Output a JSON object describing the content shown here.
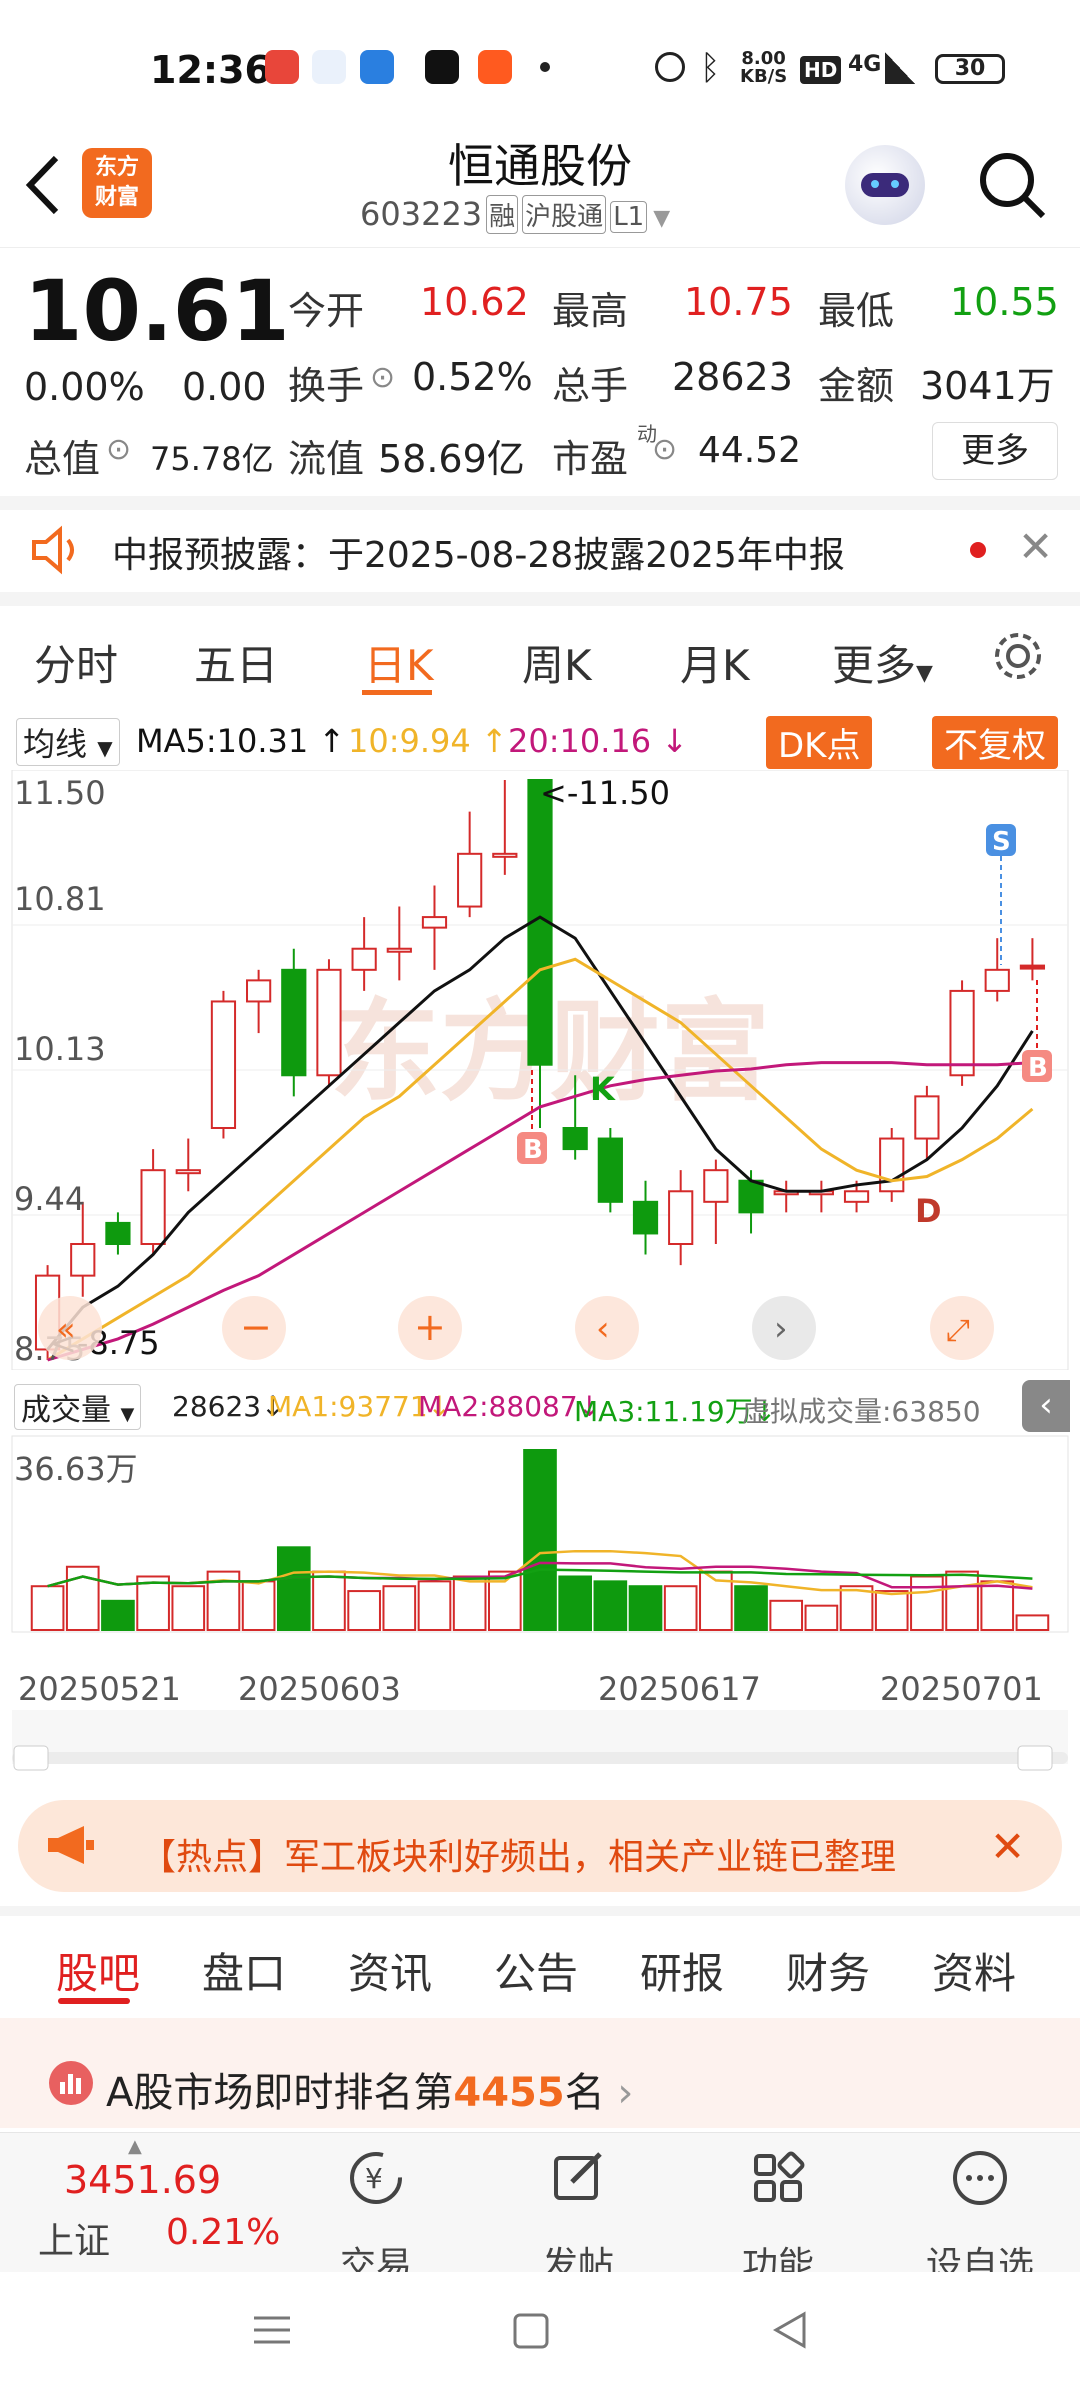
{
  "status_bar": {
    "time": "12:36",
    "net_speed_top": "8.00",
    "net_speed_bottom": "KB/S",
    "signal": "4G",
    "battery": "30"
  },
  "header": {
    "logo_line1": "东方",
    "logo_line2": "财富",
    "stock_name": "恒通股份",
    "stock_code": "603223",
    "tags": [
      "融",
      "沪股通",
      "L1"
    ]
  },
  "quote": {
    "price": "10.61",
    "change_pct": "0.00%",
    "change": "0.00",
    "fields": [
      {
        "label": "今开",
        "value": "10.62",
        "tone": "red"
      },
      {
        "label": "最高",
        "value": "10.75",
        "tone": "red"
      },
      {
        "label": "最低",
        "value": "10.55",
        "tone": "green"
      },
      {
        "label": "换手",
        "value": "0.52%",
        "tone": "black"
      },
      {
        "label": "总手",
        "value": "28623",
        "tone": "black"
      },
      {
        "label": "金额",
        "value": "3041万",
        "tone": "black"
      },
      {
        "label": "总值",
        "value": "75.78亿",
        "tone": "black"
      },
      {
        "label": "流值",
        "value": "58.69亿",
        "tone": "black"
      },
      {
        "label": "市盈",
        "value": "44.52",
        "tone": "black"
      }
    ],
    "pe_superscript": "动",
    "more_label": "更多"
  },
  "notice": {
    "text": "中报预披露：于2025-08-28披露2025年中报"
  },
  "period_tabs": [
    "分时",
    "五日",
    "日K",
    "周K",
    "月K",
    "更多"
  ],
  "ma_bar": {
    "selector": "均线",
    "ma5": "MA5:10.31",
    "ma10": "10:9.94",
    "ma20": "20:10.16",
    "dk_button": "DK点",
    "adjust_button": "不复权"
  },
  "chart_labels": {
    "y_ticks": [
      "11.50",
      "10.81",
      "10.13",
      "9.44",
      "8.75"
    ],
    "high_marker": "11.50",
    "low_marker": "8.75",
    "signals": [
      "S",
      "B",
      "B",
      "K",
      "D"
    ]
  },
  "chart_data": {
    "type": "candlestick",
    "ylim": [
      8.75,
      11.5
    ],
    "ma_colors": {
      "ma5": "#111111",
      "ma10": "#f0b429",
      "ma20": "#c2187a"
    },
    "candles": [
      {
        "o": 8.8,
        "c": 9.15,
        "h": 9.2,
        "l": 8.75,
        "up": true
      },
      {
        "o": 9.15,
        "c": 9.3,
        "h": 9.5,
        "l": 9.05,
        "up": true
      },
      {
        "o": 9.4,
        "c": 9.3,
        "h": 9.45,
        "l": 9.25,
        "up": false
      },
      {
        "o": 9.3,
        "c": 9.65,
        "h": 9.75,
        "l": 9.25,
        "up": true
      },
      {
        "o": 9.65,
        "c": 9.65,
        "h": 9.8,
        "l": 9.55,
        "up": true
      },
      {
        "o": 9.85,
        "c": 10.45,
        "h": 10.5,
        "l": 9.8,
        "up": true
      },
      {
        "o": 10.45,
        "c": 10.55,
        "h": 10.6,
        "l": 10.3,
        "up": true
      },
      {
        "o": 10.6,
        "c": 10.1,
        "h": 10.7,
        "l": 10.0,
        "up": false
      },
      {
        "o": 10.1,
        "c": 10.6,
        "h": 10.65,
        "l": 10.05,
        "up": true
      },
      {
        "o": 10.6,
        "c": 10.7,
        "h": 10.85,
        "l": 10.5,
        "up": true
      },
      {
        "o": 10.7,
        "c": 10.7,
        "h": 10.9,
        "l": 10.55,
        "up": true
      },
      {
        "o": 10.8,
        "c": 10.85,
        "h": 11.0,
        "l": 10.6,
        "up": true
      },
      {
        "o": 10.9,
        "c": 11.15,
        "h": 11.35,
        "l": 10.85,
        "up": true
      },
      {
        "o": 11.15,
        "c": 11.15,
        "h": 11.5,
        "l": 11.05,
        "up": true
      },
      {
        "o": 11.5,
        "c": 10.15,
        "h": 11.5,
        "l": 9.85,
        "up": false
      },
      {
        "o": 9.85,
        "c": 9.75,
        "h": 10.1,
        "l": 9.7,
        "up": false
      },
      {
        "o": 9.8,
        "c": 9.5,
        "h": 9.85,
        "l": 9.45,
        "up": false
      },
      {
        "o": 9.5,
        "c": 9.35,
        "h": 9.6,
        "l": 9.25,
        "up": false
      },
      {
        "o": 9.3,
        "c": 9.55,
        "h": 9.65,
        "l": 9.2,
        "up": true
      },
      {
        "o": 9.5,
        "c": 9.65,
        "h": 9.7,
        "l": 9.3,
        "up": true
      },
      {
        "o": 9.6,
        "c": 9.45,
        "h": 9.65,
        "l": 9.35,
        "up": false
      },
      {
        "o": 9.55,
        "c": 9.55,
        "h": 9.6,
        "l": 9.45,
        "up": true
      },
      {
        "o": 9.55,
        "c": 9.55,
        "h": 9.6,
        "l": 9.45,
        "up": true
      },
      {
        "o": 9.5,
        "c": 9.55,
        "h": 9.6,
        "l": 9.45,
        "up": true
      },
      {
        "o": 9.55,
        "c": 9.8,
        "h": 9.85,
        "l": 9.5,
        "up": true
      },
      {
        "o": 9.8,
        "c": 10.0,
        "h": 10.05,
        "l": 9.7,
        "up": true
      },
      {
        "o": 10.1,
        "c": 10.5,
        "h": 10.55,
        "l": 10.05,
        "up": true
      },
      {
        "o": 10.5,
        "c": 10.6,
        "h": 10.75,
        "l": 10.45,
        "up": true
      },
      {
        "o": 10.62,
        "c": 10.61,
        "h": 10.75,
        "l": 10.55,
        "up": true
      }
    ],
    "ma5": [
      8.8,
      9.0,
      9.1,
      9.25,
      9.45,
      9.6,
      9.75,
      9.9,
      10.05,
      10.2,
      10.35,
      10.5,
      10.6,
      10.75,
      10.85,
      10.75,
      10.5,
      10.25,
      10.0,
      9.75,
      9.6,
      9.55,
      9.55,
      9.58,
      9.6,
      9.7,
      9.85,
      10.05,
      10.31
    ],
    "ma10": [
      8.75,
      8.85,
      8.95,
      9.05,
      9.15,
      9.3,
      9.45,
      9.6,
      9.75,
      9.9,
      10.0,
      10.15,
      10.3,
      10.45,
      10.6,
      10.65,
      10.55,
      10.45,
      10.35,
      10.2,
      10.05,
      9.9,
      9.75,
      9.65,
      9.6,
      9.62,
      9.7,
      9.8,
      9.94
    ],
    "ma20": [
      8.75,
      8.8,
      8.85,
      8.92,
      9.0,
      9.08,
      9.15,
      9.25,
      9.35,
      9.45,
      9.55,
      9.65,
      9.75,
      9.85,
      9.95,
      10.0,
      10.05,
      10.08,
      10.1,
      10.12,
      10.13,
      10.15,
      10.16,
      10.16,
      10.16,
      10.15,
      10.15,
      10.15,
      10.16
    ]
  },
  "volume": {
    "selector": "成交量",
    "current": "28623",
    "ma1": "MA1:93771",
    "ma2": "MA2:88087",
    "ma3": "MA3:11.19万",
    "virtual": "虚拟成交量:63850",
    "max_label": "36.63万",
    "dates": [
      "20250521",
      "20250603",
      "20250617",
      "20250701"
    ],
    "bars": [
      9,
      13,
      6,
      11,
      9,
      12,
      10,
      17,
      12,
      8,
      9,
      10,
      11,
      12,
      37,
      11,
      10,
      9,
      9,
      12,
      9,
      6,
      5,
      9,
      8,
      11,
      12,
      10,
      3
    ]
  },
  "hot": {
    "text": "【热点】军工板块利好频出，相关产业链已整理"
  },
  "bottom_tabs": [
    "股吧",
    "盘口",
    "资讯",
    "公告",
    "研报",
    "财务",
    "资料"
  ],
  "rank": {
    "prefix": "A股市场即时排名第",
    "rank": "4455",
    "suffix": "名"
  },
  "bottom_nav": {
    "index_value": "3451.69",
    "index_name": "上证",
    "index_change": "0.21%",
    "items": [
      "交易",
      "发帖",
      "功能",
      "设自选"
    ]
  }
}
